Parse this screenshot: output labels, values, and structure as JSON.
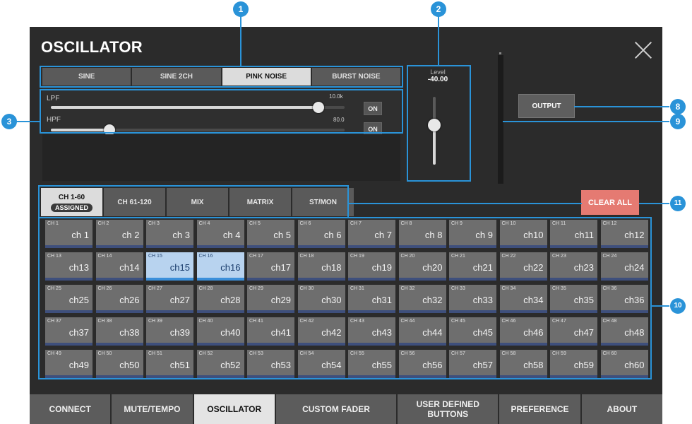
{
  "window": {
    "title": "OSCILLATOR"
  },
  "oscillator_types": [
    {
      "label": "SINE",
      "active": false
    },
    {
      "label": "SINE 2CH",
      "active": false
    },
    {
      "label": "PINK NOISE",
      "active": true
    },
    {
      "label": "BURST NOISE",
      "active": false
    }
  ],
  "filters": {
    "lpf": {
      "label": "LPF",
      "value": "10.0k",
      "position": 0.91,
      "on_label": "ON"
    },
    "hpf": {
      "label": "HPF",
      "value": "80.0",
      "position": 0.2,
      "on_label": "ON"
    }
  },
  "level": {
    "label": "Level",
    "value": "-40.00",
    "position": 0.42
  },
  "output_button": "OUTPUT",
  "clear_all_button": "CLEAR ALL",
  "channel_tabs": [
    {
      "label": "CH 1-60",
      "badge": "ASSIGNED",
      "active": true
    },
    {
      "label": "CH 61-120",
      "active": false
    },
    {
      "label": "MIX",
      "active": false
    },
    {
      "label": "MATRIX",
      "active": false
    },
    {
      "label": "ST/MON",
      "active": false
    }
  ],
  "channels": [
    {
      "id": "CH 1",
      "name": "ch 1"
    },
    {
      "id": "CH 2",
      "name": "ch 2"
    },
    {
      "id": "CH 3",
      "name": "ch 3"
    },
    {
      "id": "CH 4",
      "name": "ch 4"
    },
    {
      "id": "CH 5",
      "name": "ch 5"
    },
    {
      "id": "CH 6",
      "name": "ch 6"
    },
    {
      "id": "CH 7",
      "name": "ch 7"
    },
    {
      "id": "CH 8",
      "name": "ch 8"
    },
    {
      "id": "CH 9",
      "name": "ch 9"
    },
    {
      "id": "CH 10",
      "name": "ch10"
    },
    {
      "id": "CH 11",
      "name": "ch11"
    },
    {
      "id": "CH 12",
      "name": "ch12"
    },
    {
      "id": "CH 13",
      "name": "ch13"
    },
    {
      "id": "CH 14",
      "name": "ch14"
    },
    {
      "id": "CH 15",
      "name": "ch15",
      "selected": true
    },
    {
      "id": "CH 16",
      "name": "ch16",
      "selected": true
    },
    {
      "id": "CH 17",
      "name": "ch17"
    },
    {
      "id": "CH 18",
      "name": "ch18"
    },
    {
      "id": "CH 19",
      "name": "ch19"
    },
    {
      "id": "CH 20",
      "name": "ch20"
    },
    {
      "id": "CH 21",
      "name": "ch21"
    },
    {
      "id": "CH 22",
      "name": "ch22"
    },
    {
      "id": "CH 23",
      "name": "ch23"
    },
    {
      "id": "CH 24",
      "name": "ch24"
    },
    {
      "id": "CH 25",
      "name": "ch25"
    },
    {
      "id": "CH 26",
      "name": "ch26"
    },
    {
      "id": "CH 27",
      "name": "ch27"
    },
    {
      "id": "CH 28",
      "name": "ch28"
    },
    {
      "id": "CH 29",
      "name": "ch29"
    },
    {
      "id": "CH 30",
      "name": "ch30"
    },
    {
      "id": "CH 31",
      "name": "ch31"
    },
    {
      "id": "CH 32",
      "name": "ch32"
    },
    {
      "id": "CH 33",
      "name": "ch33"
    },
    {
      "id": "CH 34",
      "name": "ch34"
    },
    {
      "id": "CH 35",
      "name": "ch35"
    },
    {
      "id": "CH 36",
      "name": "ch36"
    },
    {
      "id": "CH 37",
      "name": "ch37"
    },
    {
      "id": "CH 38",
      "name": "ch38"
    },
    {
      "id": "CH 39",
      "name": "ch39"
    },
    {
      "id": "CH 40",
      "name": "ch40"
    },
    {
      "id": "CH 41",
      "name": "ch41"
    },
    {
      "id": "CH 42",
      "name": "ch42"
    },
    {
      "id": "CH 43",
      "name": "ch43"
    },
    {
      "id": "CH 44",
      "name": "ch44"
    },
    {
      "id": "CH 45",
      "name": "ch45"
    },
    {
      "id": "CH 46",
      "name": "ch46"
    },
    {
      "id": "CH 47",
      "name": "ch47"
    },
    {
      "id": "CH 48",
      "name": "ch48"
    },
    {
      "id": "CH 49",
      "name": "ch49"
    },
    {
      "id": "CH 50",
      "name": "ch50"
    },
    {
      "id": "CH 51",
      "name": "ch51"
    },
    {
      "id": "CH 52",
      "name": "ch52"
    },
    {
      "id": "CH 53",
      "name": "ch53"
    },
    {
      "id": "CH 54",
      "name": "ch54"
    },
    {
      "id": "CH 55",
      "name": "ch55"
    },
    {
      "id": "CH 56",
      "name": "ch56"
    },
    {
      "id": "CH 57",
      "name": "ch57"
    },
    {
      "id": "CH 58",
      "name": "ch58"
    },
    {
      "id": "CH 59",
      "name": "ch59"
    },
    {
      "id": "CH 60",
      "name": "ch60"
    }
  ],
  "bottom_nav": [
    {
      "label": "CONNECT",
      "active": false
    },
    {
      "label": "MUTE/TEMPO",
      "active": false
    },
    {
      "label": "OSCILLATOR",
      "active": true
    },
    {
      "label": "CUSTOM FADER",
      "active": false
    },
    {
      "label": "USER DEFINED BUTTONS",
      "active": false
    },
    {
      "label": "PREFERENCE",
      "active": false
    },
    {
      "label": "ABOUT",
      "active": false
    }
  ],
  "callouts": {
    "c1": "1",
    "c2": "2",
    "c3": "3",
    "c8": "8",
    "c9": "9",
    "c10": "10",
    "c11": "11"
  },
  "colors": {
    "callout_blue": "#2a93d8",
    "panel_bg": "#2b2b2b",
    "clear_all_red": "#e57a72",
    "selected_channel": "#b8d3ef"
  }
}
